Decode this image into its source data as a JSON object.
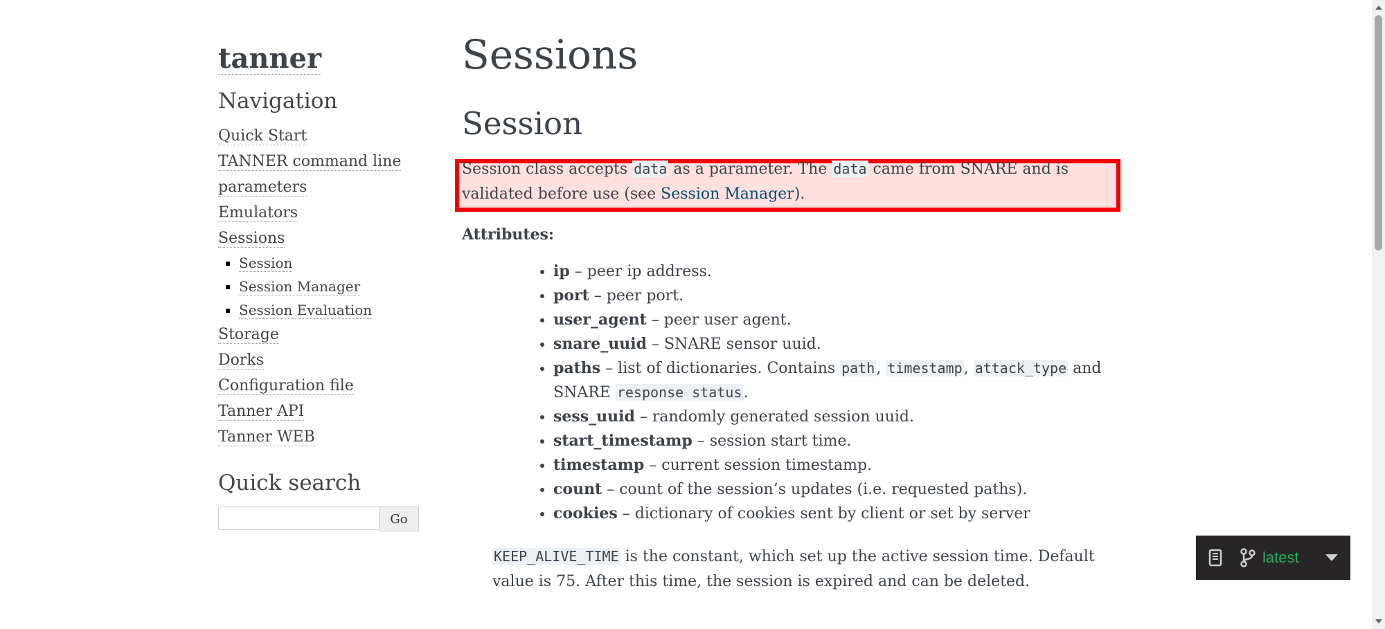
{
  "sidebar": {
    "logo": "tanner",
    "nav_title": "Navigation",
    "nav": [
      {
        "label": "Quick Start"
      },
      {
        "label": "TANNER command line"
      },
      {
        "label": "parameters"
      },
      {
        "label": "Emulators"
      },
      {
        "label": "Sessions"
      }
    ],
    "sub": [
      {
        "label": "Session"
      },
      {
        "label": "Session Manager"
      },
      {
        "label": "Session Evaluation"
      }
    ],
    "nav2": [
      {
        "label": "Storage"
      },
      {
        "label": "Dorks"
      },
      {
        "label": "Configuration file"
      },
      {
        "label": "Tanner API"
      },
      {
        "label": "Tanner WEB"
      }
    ],
    "search_title": "Quick search",
    "search_value": "",
    "go_label": "Go"
  },
  "main": {
    "title": "Sessions",
    "section_title": "Session",
    "intro": {
      "t1": "Session class accepts ",
      "c1": "data",
      "t2": " as a parameter. The ",
      "c2": "data",
      "t3": " came from SNARE and is validated before use (see ",
      "link": "Session Manager",
      "t4": ")."
    },
    "attributes_title": "Attributes:",
    "attributes": [
      {
        "name": "ip",
        "desc": " – peer ip address."
      },
      {
        "name": "port",
        "desc": " – peer port."
      },
      {
        "name": "user_agent",
        "desc": " – peer user agent."
      },
      {
        "name": "snare_uuid",
        "desc": " – SNARE sensor uuid."
      },
      {
        "name": "paths",
        "desc": " – list of dictionaries. Contains "
      },
      {
        "name": "sess_uuid",
        "desc": " – randomly generated session uuid."
      },
      {
        "name": "start_timestamp",
        "desc": " – session start time."
      },
      {
        "name": "timestamp",
        "desc": " – current session timestamp."
      },
      {
        "name": "count",
        "desc": " – count of the session’s updates (i.e. requested paths)."
      },
      {
        "name": "cookies",
        "desc": " – dictionary of cookies sent by client or set by server"
      }
    ],
    "paths_codes": {
      "c1": "path",
      "sep1": ", ",
      "c2": "timestamp",
      "sep2": ", ",
      "c3": "attack_type",
      "t_and": " and SNARE ",
      "c4": "response status",
      "end": "."
    },
    "keep_alive": {
      "code": "KEEP_ALIVE_TIME",
      "text": " is the constant, which set up the active session time. Default value is 75. After this time, the session is expired and can be deleted."
    }
  },
  "version_badge": {
    "label": "latest",
    "icons": [
      "book-icon",
      "branch-icon",
      "caret-down-icon"
    ],
    "accent_color": "#27ae60"
  },
  "highlight_color": "#f00000"
}
